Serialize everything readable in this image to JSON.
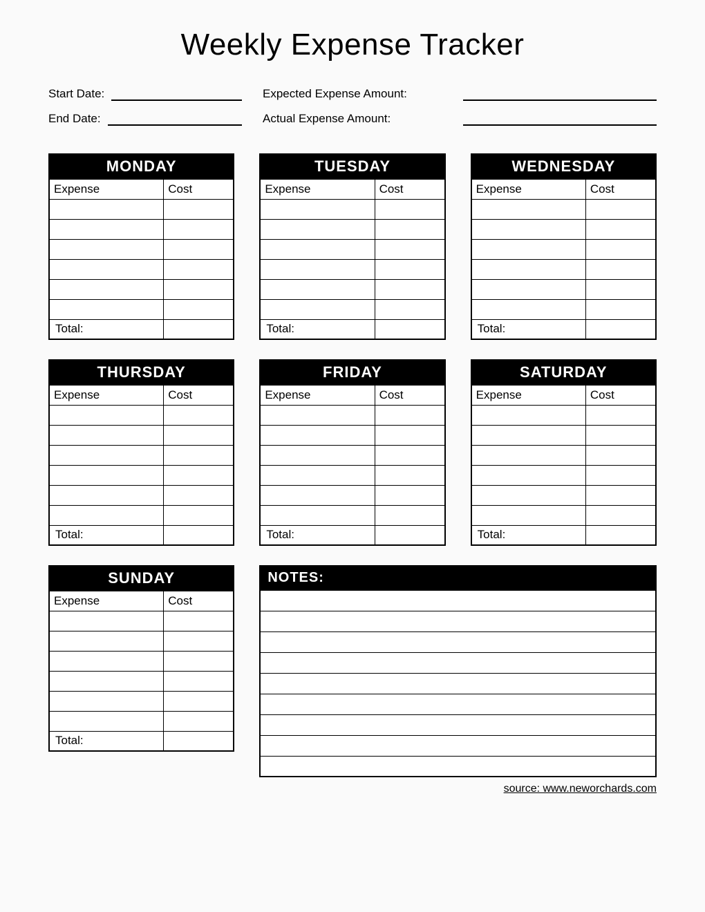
{
  "title": "Weekly Expense Tracker",
  "header": {
    "start_date_label": "Start Date:",
    "end_date_label": "End Date:",
    "expected_label": "Expected Expense Amount:",
    "actual_label": "Actual Expense Amount:"
  },
  "columns": {
    "expense": "Expense",
    "cost": "Cost"
  },
  "total_label": "Total:",
  "days": [
    {
      "name": "MONDAY"
    },
    {
      "name": "TUESDAY"
    },
    {
      "name": "WEDNESDAY"
    },
    {
      "name": "THURSDAY"
    },
    {
      "name": "FRIDAY"
    },
    {
      "name": "SATURDAY"
    },
    {
      "name": "SUNDAY"
    }
  ],
  "notes_label": "NOTES:",
  "notes_row_count": 9,
  "expense_row_count": 6,
  "source": "source: www.neworchards.com"
}
